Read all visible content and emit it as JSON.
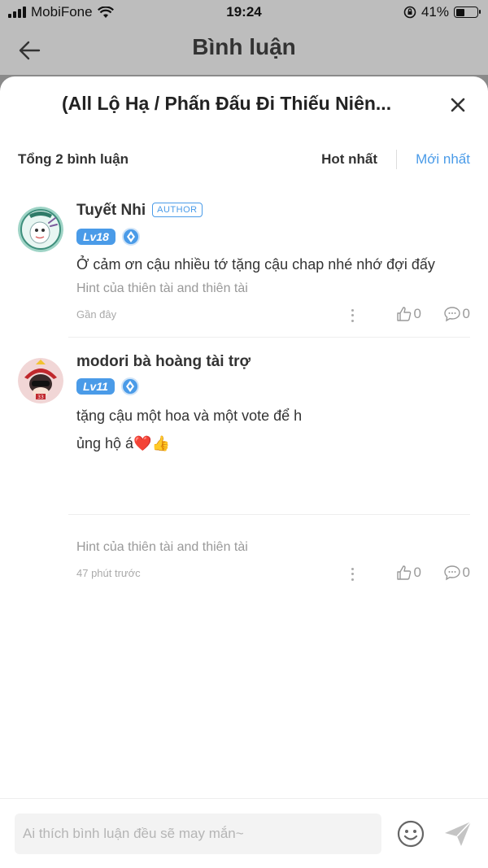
{
  "status_bar": {
    "carrier": "MobiFone",
    "time": "19:24",
    "battery_percent": "41%",
    "battery_level": 0.41
  },
  "nav": {
    "title": "Bình luận"
  },
  "sheet": {
    "title": "(All Lộ Hạ / Phấn Đấu Đi Thiếu Niên..."
  },
  "summary": {
    "total": "Tổng 2 bình luận",
    "sort_hot": "Hot nhất",
    "sort_new": "Mới nhất"
  },
  "comments": [
    {
      "author": "Tuyết Nhi",
      "author_badge": "AUTHOR",
      "level": "Lv18",
      "text_lines": [
        "Ở cảm ơn cậu nhiều tớ tặng cậu chap nhé nhớ đợi đấy"
      ],
      "hint": "Hint của thiên tài and thiên tài",
      "time": "Gần đây",
      "likes": "0",
      "replies": "0"
    },
    {
      "author": "modori bà hoàng tài trợ",
      "level": "Lv11",
      "text_lines": [
        "tặng cậu một hoa và một vote để h",
        "ủng hộ á❤️👍"
      ],
      "hint": "Hint của thiên tài and thiên tài",
      "time": "47 phút trước",
      "likes": "0",
      "replies": "0"
    }
  ],
  "input": {
    "placeholder": "Ai thích bình luận đều sẽ may mắn~"
  },
  "colors": {
    "accent": "#4a9be8",
    "overlay": "#bdbdbd"
  }
}
